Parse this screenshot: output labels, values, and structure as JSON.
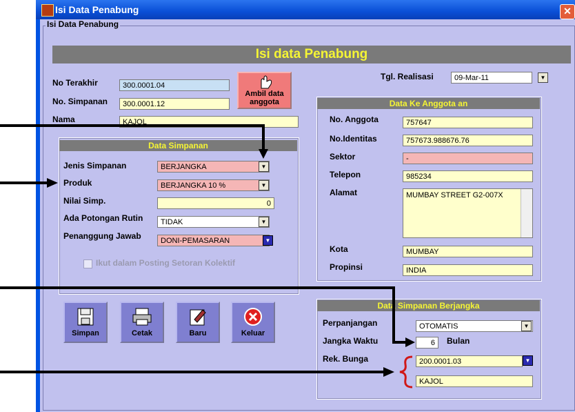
{
  "window": {
    "title": "Isi Data Penabung",
    "close_glyph": "✕"
  },
  "group_label": "Isi Data Penabung",
  "banner": "Isi data Penabung",
  "top": {
    "no_terakhir_label": "No Terakhir",
    "no_terakhir_value": "300.0001.04",
    "no_simpanan_label": "No. Simpanan",
    "no_simpanan_value": "300.0001.12",
    "nama_label": "Nama",
    "nama_value": "KAJOL",
    "ambil_label": "Ambil data anggota",
    "tgl_label": "Tgl. Realisasi",
    "tgl_value": "09-Mar-11"
  },
  "data_simpanan": {
    "title": "Data Simpanan",
    "jenis_label": "Jenis Simpanan",
    "jenis_value": "BERJANGKA",
    "produk_label": "Produk",
    "produk_value": "BERJANGKA 10 %",
    "nilai_label": "Nilai Simp.",
    "nilai_value": "0",
    "potongan_label": "Ada Potongan Rutin",
    "potongan_value": "TIDAK",
    "penanggung_label": "Penanggung Jawab",
    "penanggung_value": "DONI-PEMASARAN",
    "ikut_label": "Ikut dalam Posting Setoran Kolektif"
  },
  "data_anggota": {
    "title": "Data Ke Anggota an",
    "no_anggota_label": "No. Anggota",
    "no_anggota_value": "757647",
    "identitas_label": "No.Identitas",
    "identitas_value": "757673.988676.76",
    "sektor_label": "Sektor",
    "sektor_value": "-",
    "telepon_label": "Telepon",
    "telepon_value": "985234",
    "alamat_label": "Alamat",
    "alamat_value": "MUMBAY STREET G2-007X",
    "kota_label": "Kota",
    "kota_value": "MUMBAY",
    "propinsi_label": "Propinsi",
    "propinsi_value": "INDIA"
  },
  "berjangka": {
    "title": "Data Simpanan Berjangka",
    "perpanjangan_label": "Perpanjangan",
    "perpanjangan_value": "OTOMATIS",
    "jangka_label": "Jangka Waktu",
    "jangka_value": "6",
    "jangka_unit": "Bulan",
    "rek_label": "Rek. Bunga",
    "rek_value": "200.0001.03",
    "rek_name": "KAJOL"
  },
  "buttons": {
    "simpan": "Simpan",
    "cetak": "Cetak",
    "baru": "Baru",
    "keluar": "Keluar"
  }
}
